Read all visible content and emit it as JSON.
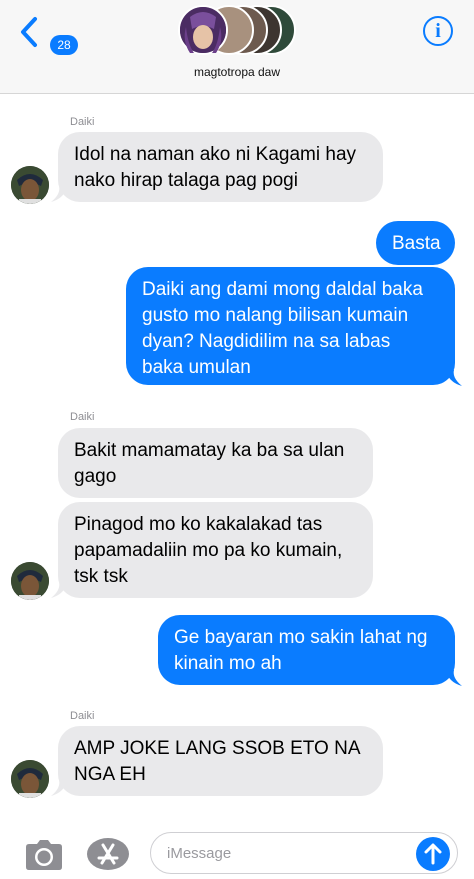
{
  "header": {
    "back_count": "28",
    "group_name": "magtotropa daw",
    "info_glyph": "i",
    "accent_color": "#0a7cff"
  },
  "messages": [
    {
      "sender": "Daiki",
      "text": "Idol na naman ako ni Kagami hay\nnako hirap talaga pag pogi"
    },
    {
      "text": "Basta"
    },
    {
      "text": "Daiki ang dami mong daldal baka\ngusto mo nalang bilisan kumain\ndyan? Nagdidilim na sa labas\nbaka umulan"
    },
    {
      "sender": "Daiki",
      "text": "Bakit mamamatay ka ba sa ulan\ngago"
    },
    {
      "text": "Pinagod mo ko kakalakad tas\npapamadaliin mo pa ko kumain,\ntsk tsk"
    },
    {
      "text": "Ge bayaran mo sakin lahat ng\nkinain mo ah"
    },
    {
      "sender": "Daiki",
      "text": "AMP JOKE LANG SSOB ETO NA\nNGA EH"
    }
  ],
  "composer": {
    "placeholder": "iMessage",
    "icons": [
      "camera-icon",
      "app-store-icon",
      "send-arrow-icon"
    ]
  }
}
